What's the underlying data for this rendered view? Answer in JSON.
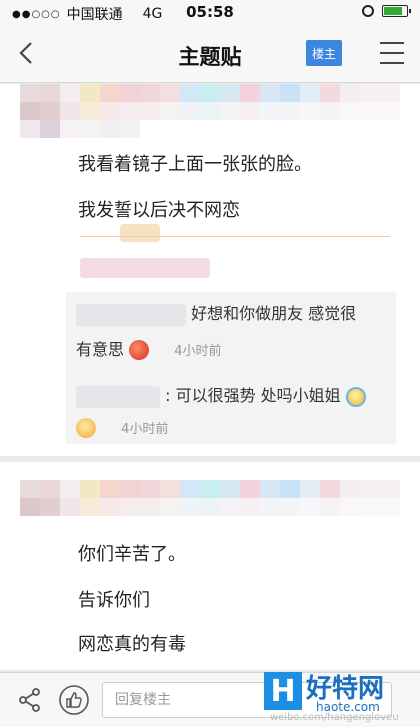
{
  "status_bar": {
    "signal": "●●○○○",
    "carrier": "中国联通",
    "network": "4G",
    "time": "05:58"
  },
  "nav": {
    "title": "主题贴",
    "owner_button": "楼主"
  },
  "post1": {
    "lines": [
      "我看着镜子上面一张张的脸。",
      "我发誓以后决不网恋"
    ],
    "replies": [
      {
        "text": "好想和你做朋友 感觉很",
        "text2": "有意思",
        "time": "4小时前"
      },
      {
        "text": ": 可以很强势 处吗小姐姐",
        "time": "4小时前"
      }
    ]
  },
  "post2": {
    "lines": [
      "你们辛苦了。",
      "告诉你们",
      "网恋真的有毒"
    ]
  },
  "bottom_bar": {
    "reply_placeholder": "回复楼主"
  },
  "watermark": {
    "logo_letter": "H",
    "name": "好特网",
    "site": "haote.com",
    "weibo": "weibo.com/hangengloveu"
  },
  "colors": {
    "accent": "#3d86e0",
    "battery": "#33aa33"
  }
}
